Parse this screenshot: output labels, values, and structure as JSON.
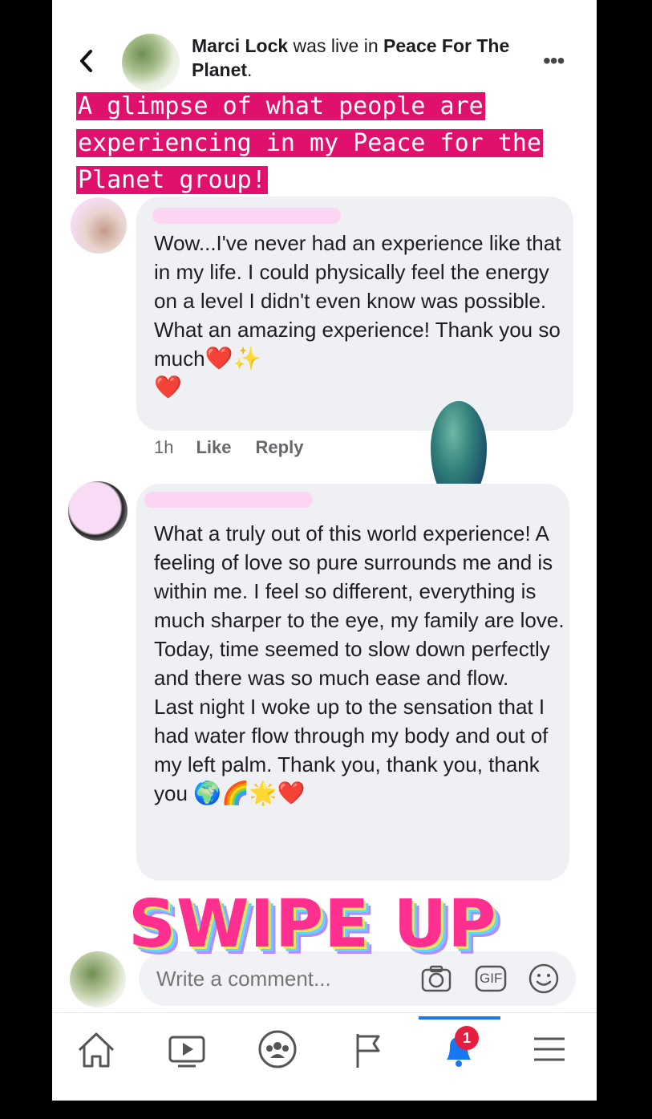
{
  "header": {
    "back_icon": "chevron-left-icon",
    "author": "Marci Lock",
    "mid": " was live in ",
    "group": "Peace For The Planet",
    "end": ".",
    "more_icon": "more-horizontal-icon"
  },
  "overlay_caption": "A glimpse of what people are experiencing in my Peace for the Planet group!",
  "comments": [
    {
      "text": "Wow...I've never had an experience like that in my life.  I could physically feel the energy on a level I didn't even know was possible.  What an amazing experience!  Thank you so much",
      "emojis": "❤️✨",
      "emojis2": "❤️",
      "time": "1h",
      "like": "Like",
      "reply": "Reply"
    },
    {
      "text": "What a truly out of this world experience! A feeling of love so pure surrounds me and is within me. I feel so different, everything is much sharper to the eye, my family are love. Today, time seemed to slow down perfectly and there was so much ease and flow.\nLast night I woke up to the sensation that I had water flow through my body and out of my left palm. Thank you, thank you, thank you",
      "emojis": "🌍🌈🌟❤️"
    }
  ],
  "sticker": "SWIPE UP",
  "composer": {
    "placeholder": "Write a comment...",
    "icons": [
      "camera-icon",
      "gif-icon",
      "emoji-icon"
    ],
    "gif_label": "GIF"
  },
  "nav": {
    "items": [
      "home-icon",
      "watch-icon",
      "groups-icon",
      "pages-icon",
      "notifications-icon",
      "menu-icon"
    ],
    "active": "notifications-icon",
    "notification_count": "1",
    "colors": {
      "active": "#1877f2",
      "badge": "#e41e3f",
      "caption_bg": "#e0116c"
    }
  }
}
